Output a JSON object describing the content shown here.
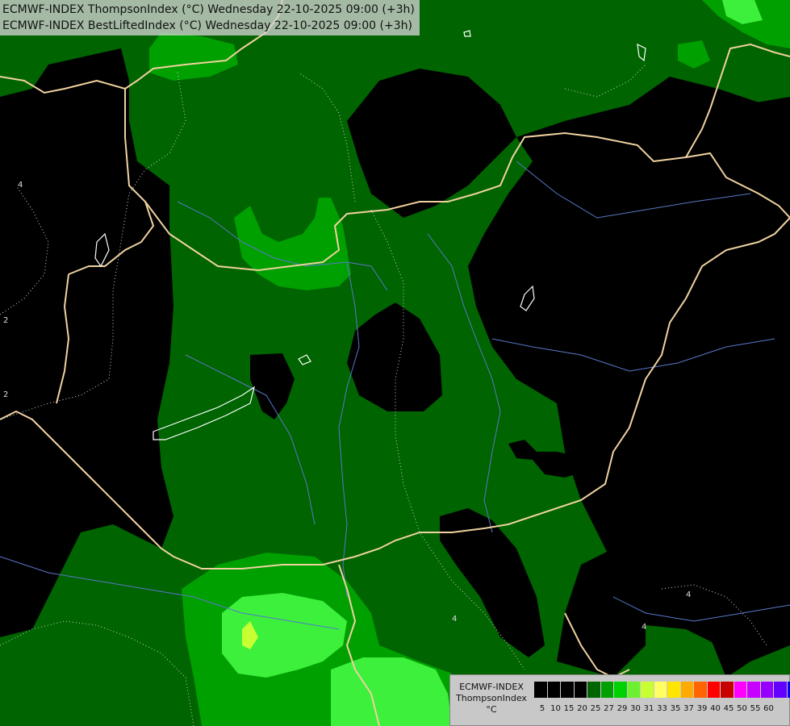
{
  "header": {
    "line1": "ECMWF-INDEX ThompsonIndex (°C) Wednesday 22-10-2025 09:00 (+3h)",
    "line2": "ECMWF-INDEX BestLiftedIndex (°C) Wednesday 22-10-2025 09:00 (+3h)"
  },
  "legend": {
    "title_line1": "ECMWF-INDEX",
    "title_line2": "ThompsonIndex",
    "unit": "°C",
    "colors": [
      "#000000",
      "#000000",
      "#000000",
      "#000000",
      "#006400",
      "#00a000",
      "#00d200",
      "#6ef030",
      "#c8ff32",
      "#ffff64",
      "#ffe600",
      "#ffaa00",
      "#ff6400",
      "#ff0000",
      "#c80000",
      "#ff00ff",
      "#c800ff",
      "#9600ff",
      "#6400ff",
      "#0000ff"
    ],
    "ticks": [
      "5",
      "10",
      "15",
      "20",
      "25",
      "27",
      "29",
      "30",
      "31",
      "33",
      "35",
      "37",
      "39",
      "40",
      "45",
      "50",
      "55",
      "60"
    ]
  },
  "contour_labels": [
    "4",
    "2",
    "2",
    "4",
    "4",
    "4"
  ],
  "map_colors": {
    "background": "#000000",
    "band_dark": "#006400",
    "band_mid": "#00a000",
    "band_light": "#00d200",
    "band_bright": "#3cf03c",
    "band_lime": "#c8ff32",
    "border": "#f0d2a0",
    "river": "#5a78c8",
    "lake": "#ffffff"
  }
}
